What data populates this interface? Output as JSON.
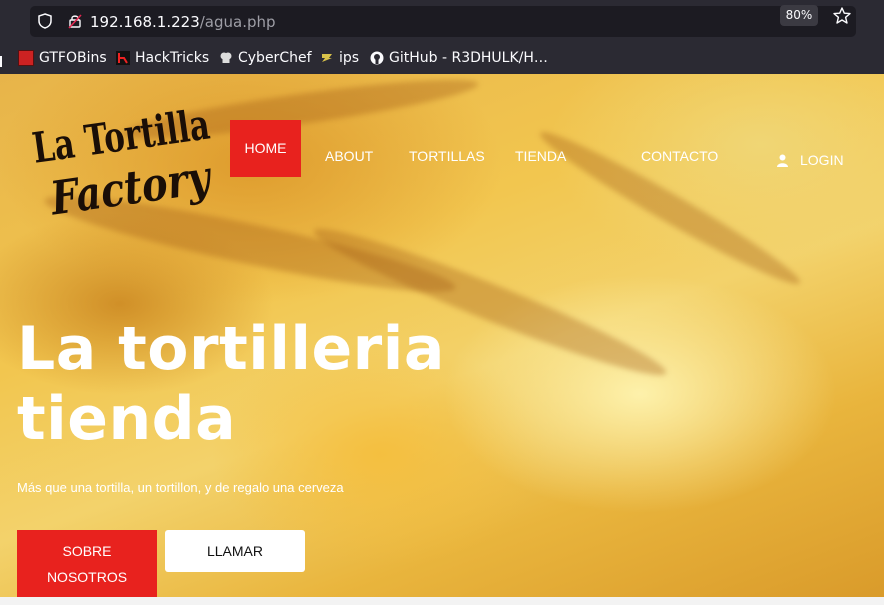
{
  "browser": {
    "url_host": "192.168.1.223",
    "url_path": "/agua.php",
    "zoom": "80%",
    "bookmarks": [
      {
        "label": "GTFOBins",
        "icon": "gtfobins-icon"
      },
      {
        "label": "HackTricks",
        "icon": "hacktricks-icon"
      },
      {
        "label": "CyberChef",
        "icon": "cyberchef-icon"
      },
      {
        "label": "ips",
        "icon": "ips-icon"
      },
      {
        "label": "GitHub - R3DHULK/H…",
        "icon": "github-icon"
      }
    ]
  },
  "site": {
    "logo_line1": "La Tortilla",
    "logo_line2": "Factory",
    "nav": {
      "home": "HOME",
      "about": "ABOUT",
      "tortillas": "TORTILLAS",
      "tienda": "TIENDA",
      "contacto": "CONTACTO",
      "login": "LOGIN"
    },
    "hero": {
      "title_line1": "La tortilleria",
      "title_line2": "tienda",
      "subtitle": "Más que una tortilla, un tortillon, y de regalo una cerveza",
      "primary_button": "SOBRE NOSOTROS",
      "secondary_button": "LLAMAR"
    }
  },
  "colors": {
    "accent_red": "#e8221e",
    "chrome_bg": "#2b2a33",
    "urlbar_bg": "#1c1b22"
  }
}
